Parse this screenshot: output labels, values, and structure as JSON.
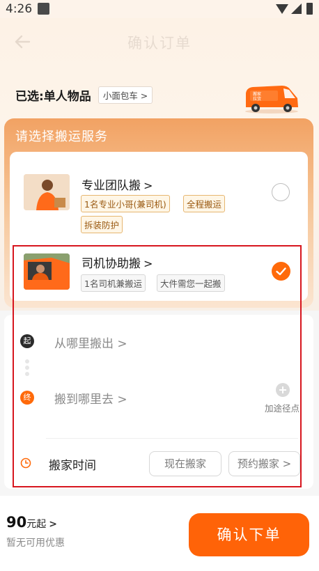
{
  "status_bar": {
    "time": "4:26"
  },
  "header": {
    "title": "确认订单"
  },
  "selection": {
    "text": "已选:单人物品",
    "vehicle": "小面包车 >"
  },
  "service": {
    "title": "请选择搬运服务",
    "items": [
      {
        "name": "专业团队搬",
        "chevron": ">",
        "tags": [
          "1名专业小哥(兼司机)",
          "全程搬运",
          "拆装防护"
        ],
        "selected": false
      },
      {
        "name": "司机协助搬",
        "chevron": ">",
        "tags": [
          "1名司机兼搬运",
          "大件需您一起搬"
        ],
        "selected": true
      }
    ]
  },
  "address": {
    "start_badge": "起",
    "end_badge": "终",
    "from_placeholder": "从哪里搬出 >",
    "to_placeholder": "搬到哪里去 >",
    "waypoint_label": "加途径点"
  },
  "move_time": {
    "label": "搬家时间",
    "now": "现在搬家",
    "schedule": "预约搬家 >"
  },
  "footer": {
    "price_value": "90",
    "price_unit": "元起",
    "price_chevron": ">",
    "coupon": "暂无可用优惠",
    "confirm": "确认下单"
  },
  "colors": {
    "accent": "#ff6308",
    "annotation": "#d7151e"
  }
}
